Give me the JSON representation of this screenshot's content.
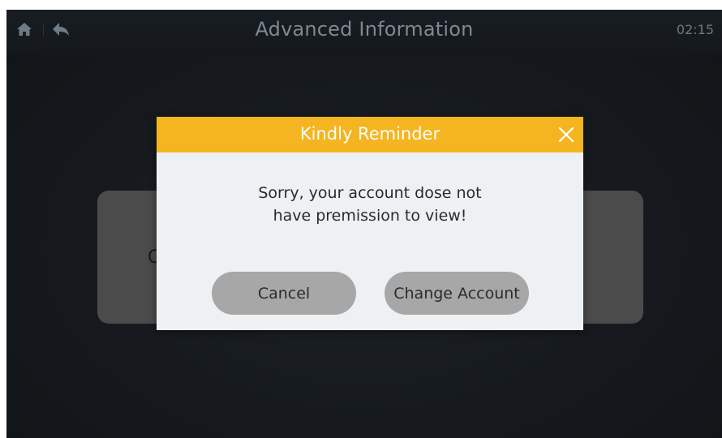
{
  "header": {
    "title": "Advanced Information",
    "time": "02:15",
    "home_icon": "home-icon",
    "back_icon": "back-icon"
  },
  "background_card": {
    "fragment": "C"
  },
  "dialog": {
    "title": "Kindly Reminder",
    "message_line1": "Sorry, your account dose not",
    "message_line2": "have premission to view!",
    "cancel_label": "Cancel",
    "change_account_label": "Change Account",
    "close_icon": "close-icon"
  },
  "colors": {
    "accent": "#f4b521",
    "background": "#15191d",
    "dialog_body": "#eef1f3",
    "button": "#a7a7a7"
  }
}
